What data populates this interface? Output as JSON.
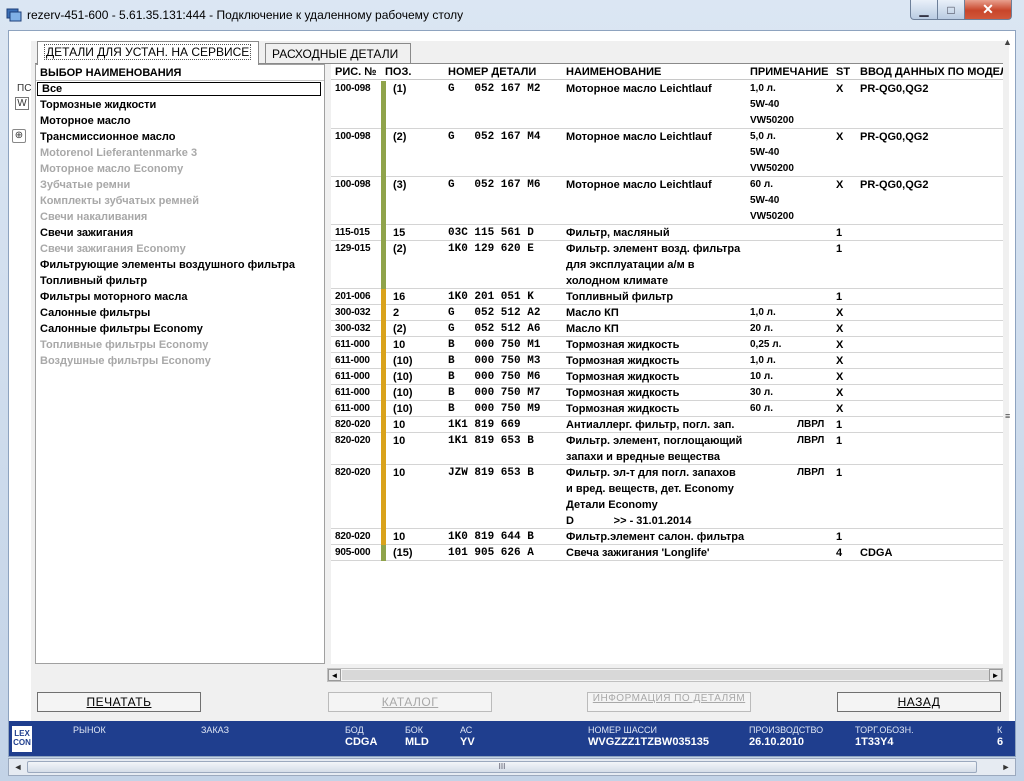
{
  "window": {
    "title": "rezerv-451-600 - 5.61.35.131:444 - Подключение к удаленному рабочему столу",
    "min_label": "▁",
    "max_label": "□",
    "close_label": "✕"
  },
  "left_strip": {
    "label1": "ПС",
    "label2": "W",
    "label3": "⊕"
  },
  "tabs": [
    {
      "label": "ДЕТАЛИ ДЛЯ УСТАН. НА СЕРВИСЕ"
    },
    {
      "label": "РАСХОДНЫЕ ДЕТАЛИ"
    }
  ],
  "list": {
    "header": "ВЫБОР НАИМЕНОВАНИЯ",
    "items": [
      {
        "label": "Все"
      },
      {
        "label": "Тормозные жидкости"
      },
      {
        "label": "Моторное масло"
      },
      {
        "label": "Трансмиссионное масло"
      },
      {
        "label": "Motorenol Lieferantenmarke 3"
      },
      {
        "label": "Моторное масло Economy"
      },
      {
        "label": "Зубчатые ремни"
      },
      {
        "label": "Комплекты зубчатых ремней"
      },
      {
        "label": "Свечи накаливания"
      },
      {
        "label": "Свечи зажигания"
      },
      {
        "label": "Свечи зажигания Economy"
      },
      {
        "label": "Фильтрующие элементы воздушного фильтра"
      },
      {
        "label": "Топливный фильтр"
      },
      {
        "label": "Фильтры моторного масла"
      },
      {
        "label": "Салонные фильтры"
      },
      {
        "label": "Салонные фильтры Economy"
      },
      {
        "label": "Топливные фильтры Economy"
      },
      {
        "label": "Воздушные фильтры Economy"
      }
    ]
  },
  "grid": {
    "columns": {
      "fig": "РИС. №",
      "pos": "ПОЗ.",
      "part": "НОМЕР ДЕТАЛИ",
      "name": "НАИМЕНОВАНИЕ",
      "note": "ПРИМЕЧАНИЕ",
      "st": "ST",
      "model": "ВВОД ДАННЫХ ПО МОДЕЛИ"
    },
    "rows": [
      {
        "fig": "100-098",
        "pos": "(1)",
        "part": "G   052 167 M2",
        "name": [
          "Моторное масло Leichtlauf"
        ],
        "note": [
          "1,0 л.",
          "5W-40",
          "VW50200"
        ],
        "st": "X",
        "model": "PR-QG0,QG2"
      },
      {
        "fig": "100-098",
        "pos": "(2)",
        "part": "G   052 167 M4",
        "name": [
          "Моторное масло Leichtlauf"
        ],
        "note": [
          "5,0 л.",
          "5W-40",
          "VW50200"
        ],
        "st": "X",
        "model": "PR-QG0,QG2"
      },
      {
        "fig": "100-098",
        "pos": "(3)",
        "part": "G   052 167 M6",
        "name": [
          "Моторное масло Leichtlauf"
        ],
        "note": [
          "60 л.",
          "5W-40",
          "VW50200"
        ],
        "st": "X",
        "model": "PR-QG0,QG2"
      },
      {
        "fig": "115-015",
        "pos": "15",
        "part": "03C 115 561 D",
        "name": [
          "Фильтр, масляный"
        ],
        "note": [],
        "st": "1",
        "model": ""
      },
      {
        "fig": "129-015",
        "pos": "(2)",
        "part": "1K0 129 620 E",
        "name": [
          "Фильтр. элемент возд. фильтра",
          "для эксплуатации а/м в",
          "холодном климате"
        ],
        "note": [],
        "st": "1",
        "model": ""
      },
      {
        "fig": "201-006",
        "pos": "16",
        "part": "1K0 201 051 K",
        "name": [
          "Топливный фильтр"
        ],
        "note": [],
        "st": "1",
        "model": ""
      },
      {
        "fig": "300-032",
        "pos": "2",
        "part": "G   052 512 A2",
        "name": [
          "Масло КП"
        ],
        "note": [
          "1,0 л."
        ],
        "st": "X",
        "model": ""
      },
      {
        "fig": "300-032",
        "pos": "(2)",
        "part": "G   052 512 A6",
        "name": [
          "Масло КП"
        ],
        "note": [
          "20 л."
        ],
        "st": "X",
        "model": ""
      },
      {
        "fig": "611-000",
        "pos": "10",
        "part": "B   000 750 M1",
        "name": [
          "Тормозная жидкость"
        ],
        "note": [
          "0,25 л."
        ],
        "st": "X",
        "model": ""
      },
      {
        "fig": "611-000",
        "pos": "(10)",
        "part": "B   000 750 M3",
        "name": [
          "Тормозная жидкость"
        ],
        "note": [
          "1,0 л."
        ],
        "st": "X",
        "model": ""
      },
      {
        "fig": "611-000",
        "pos": "(10)",
        "part": "B   000 750 M6",
        "name": [
          "Тормозная жидкость"
        ],
        "note": [
          "10 л."
        ],
        "st": "X",
        "model": ""
      },
      {
        "fig": "611-000",
        "pos": "(10)",
        "part": "B   000 750 M7",
        "name": [
          "Тормозная жидкость"
        ],
        "note": [
          "30 л."
        ],
        "st": "X",
        "model": ""
      },
      {
        "fig": "611-000",
        "pos": "(10)",
        "part": "B   000 750 M9",
        "name": [
          "Тормозная жидкость"
        ],
        "note": [
          "60 л."
        ],
        "st": "X",
        "model": ""
      },
      {
        "fig": "820-020",
        "pos": "10",
        "part": "1K1 819 669",
        "name": [
          "Антиаллерг. фильтр, погл. зап."
        ],
        "note": [
          "ЛВРЛ"
        ],
        "st": "1",
        "model": ""
      },
      {
        "fig": "820-020",
        "pos": "10",
        "part": "1K1 819 653 B",
        "name": [
          "Фильтр. элемент, поглощающий",
          "запахи и вредные вещества"
        ],
        "note": [
          "ЛВРЛ"
        ],
        "st": "1",
        "model": ""
      },
      {
        "fig": "820-020",
        "pos": "10",
        "part": "JZW 819 653 B",
        "name": [
          "Фильтр. эл-т для погл. запахов",
          "и вред. веществ, дет. Economy",
          "Детали Economy",
          "D             >> - 31.01.2014"
        ],
        "note": [
          "ЛВРЛ"
        ],
        "st": "1",
        "model": ""
      },
      {
        "fig": "820-020",
        "pos": "10",
        "part": "1K0 819 644 B",
        "name": [
          "Фильтр.элемент салон. фильтра"
        ],
        "note": [],
        "st": "1",
        "model": ""
      },
      {
        "fig": "905-000",
        "pos": "(15)",
        "part": "101 905 626 A",
        "name": [
          "Свеча зажигания 'Longlife'"
        ],
        "note": [],
        "st": "4",
        "model": "CDGA"
      }
    ]
  },
  "buttons": {
    "print": "ПЕЧАТАТЬ",
    "catalog": "КАТАЛОГ",
    "info": "ИНФОРМАЦИЯ ПО ДЕТАЛЯМ",
    "back": "НАЗАД"
  },
  "status": {
    "logo": "LEX CON",
    "market_label": "РЫНОК",
    "order_label": "ЗАКАЗ",
    "bod_label": "БОД",
    "bod_value": "CDGA",
    "bok_label": "БОК",
    "bok_value": "MLD",
    "ac_label": "АС",
    "ac_value": "YV",
    "chassis_label": "НОМЕР ШАССИ",
    "chassis_value": "WVGZZZ1TZBW035135",
    "prod_label": "ПРОИЗВОДСТВО",
    "prod_value": "26.10.2010",
    "trade_label": "ТОРГ.ОБОЗН.",
    "trade_value": "1T33Y4",
    "extra_label": "К",
    "extra_value": "6"
  },
  "scroll": {
    "left_arrow": "◄",
    "right_arrow": "►",
    "grip": "III"
  },
  "colors": {
    "bar_green": "#8fa34a",
    "bar_orange": "#d9a21b",
    "status_blue": "#1f3e8e"
  }
}
